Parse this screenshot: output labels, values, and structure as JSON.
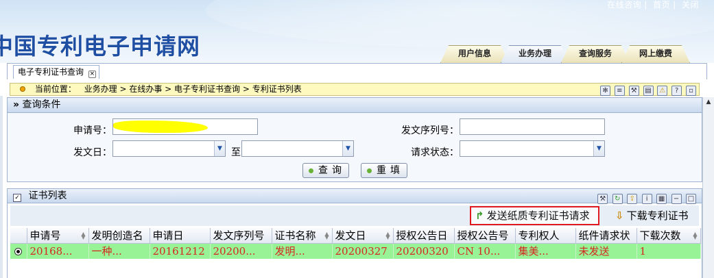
{
  "header": {
    "top_links": [
      "在线咨询",
      "首页",
      "关闭"
    ],
    "site_title": "中国专利电子申请网",
    "nav_tabs": [
      "用户信息",
      "业务办理",
      "查询服务",
      "网上缴费"
    ],
    "active_nav": "业务办理"
  },
  "doc_tab": {
    "label": "电子专利证书查询"
  },
  "breadcrumb": {
    "prefix": "当前位置：",
    "path": "业务办理 > 在线办事 > 电子专利证书查询 > 专利证书列表"
  },
  "query": {
    "title": "查询条件",
    "labels": {
      "application_no": "申请号：",
      "issue_date": "发文日：",
      "to": "至",
      "serial_no": "发文序列号：",
      "request_status": "请求状态："
    },
    "values": {
      "application_no": "",
      "issue_date_from": "",
      "issue_date_to": "",
      "serial_no": "",
      "request_status": ""
    },
    "buttons": {
      "search": "查询",
      "reset": "重填"
    }
  },
  "cert_list": {
    "title": "证书列表",
    "toolbar": {
      "send_paper_request": "发送纸质专利证书请求",
      "download": "下载专利证书"
    },
    "columns": [
      "申请号",
      "发明创造名",
      "申请日",
      "发文序列号",
      "证书名称",
      "发文日",
      "授权公告日",
      "授权公告号",
      "专利权人",
      "纸件请求状",
      "下载次数"
    ],
    "rows": [
      {
        "selected": true,
        "cells": [
          "20168...",
          "一种...",
          "20161212",
          "20200...",
          "发明...",
          "20200327",
          "20200320",
          "CN 10...",
          "集美...",
          "未发送",
          "1"
        ]
      }
    ]
  },
  "colors": {
    "title_blue": "#1f4fa3",
    "breadcrumb_bg": "#fdf9bf",
    "row_highlight": "#97f396",
    "row_text": "#d5281d",
    "callout_red": "#e0191f"
  }
}
